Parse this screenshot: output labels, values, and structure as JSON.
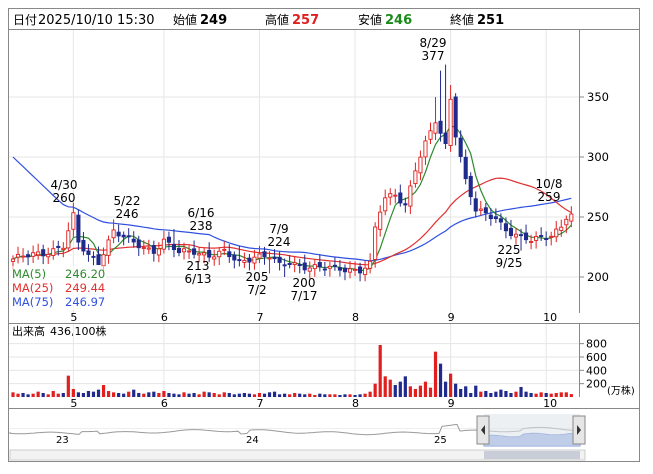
{
  "header": {
    "date_label": "日付",
    "datetime": "2025/10/10 15:30",
    "open_label": "始値",
    "open": "249",
    "high_label": "高値",
    "high": "257",
    "low_label": "安値",
    "low": "246",
    "close_label": "終値",
    "close": "251"
  },
  "legend": {
    "ma5": "MA(5)",
    "ma5_value": "246.20",
    "ma25": "MA(25)",
    "ma25_value": "249.44",
    "ma75": "MA(75)",
    "ma75_value": "246.97"
  },
  "volume_header": {
    "label": "出来高",
    "value": "436,100株"
  },
  "volume_unit": "(万株)",
  "navigator_labels": [
    "23",
    "24",
    "25"
  ],
  "colors": {
    "candle_up": "#e0201f",
    "candle_down": "#1f2a8c",
    "ma5": "#2e8b2e",
    "ma25": "#e03030",
    "ma75": "#3050e0",
    "header_high": "#e0201f",
    "header_low": "#1a8a1a",
    "volume_up": "#e0201f",
    "volume_down": "#1f2a8c",
    "navigator_fill": "#7f9fe0",
    "navigator_thumb": "#c8cdd8"
  },
  "chart_data": [
    {
      "type": "candlestick",
      "title": "",
      "x_ticks": [
        "5",
        "6",
        "7",
        "8",
        "9",
        "10"
      ],
      "y_ticks": [
        200,
        250,
        300,
        350
      ],
      "ylim": [
        170,
        390
      ],
      "grid": true,
      "annotations": [
        {
          "date": "4/30",
          "value": "260"
        },
        {
          "date": "5/22",
          "value": "246"
        },
        {
          "date": "6/16",
          "value": "238"
        },
        {
          "date": "6/13",
          "value": "213"
        },
        {
          "date": "7/9",
          "value": "224"
        },
        {
          "date": "7/2",
          "value": "205"
        },
        {
          "date": "7/17",
          "value": "200"
        },
        {
          "date": "8/29",
          "value": "377"
        },
        {
          "date": "9/25",
          "value": "225"
        },
        {
          "date": "10/8",
          "value": "259"
        }
      ],
      "anchors": [
        {
          "x": 0,
          "v": 215
        },
        {
          "x": 6,
          "v": 220
        },
        {
          "x": 10,
          "v": 226
        },
        {
          "x": 12,
          "v": 250
        },
        {
          "x": 13,
          "v": 228
        },
        {
          "x": 15,
          "v": 218
        },
        {
          "x": 17,
          "v": 213
        },
        {
          "x": 19,
          "v": 230
        },
        {
          "x": 20,
          "v": 238
        },
        {
          "x": 23,
          "v": 230
        },
        {
          "x": 26,
          "v": 225
        },
        {
          "x": 28,
          "v": 222
        },
        {
          "x": 30,
          "v": 230
        },
        {
          "x": 33,
          "v": 220
        },
        {
          "x": 36,
          "v": 222
        },
        {
          "x": 39,
          "v": 218
        },
        {
          "x": 42,
          "v": 220
        },
        {
          "x": 45,
          "v": 212
        },
        {
          "x": 48,
          "v": 218
        },
        {
          "x": 51,
          "v": 217
        },
        {
          "x": 53,
          "v": 209
        },
        {
          "x": 55,
          "v": 212
        },
        {
          "x": 57,
          "v": 210
        },
        {
          "x": 60,
          "v": 208
        },
        {
          "x": 63,
          "v": 207
        },
        {
          "x": 66,
          "v": 207
        },
        {
          "x": 69,
          "v": 206
        },
        {
          "x": 71,
          "v": 210
        },
        {
          "x": 72,
          "v": 240
        },
        {
          "x": 73,
          "v": 255
        },
        {
          "x": 74,
          "v": 265
        },
        {
          "x": 76,
          "v": 270
        },
        {
          "x": 78,
          "v": 260
        },
        {
          "x": 80,
          "v": 290
        },
        {
          "x": 82,
          "v": 310
        },
        {
          "x": 84,
          "v": 330
        },
        {
          "x": 86,
          "v": 310
        },
        {
          "x": 87,
          "v": 350
        },
        {
          "x": 88,
          "v": 320
        },
        {
          "x": 89,
          "v": 300
        },
        {
          "x": 90,
          "v": 280
        },
        {
          "x": 92,
          "v": 255
        },
        {
          "x": 94,
          "v": 252
        },
        {
          "x": 96,
          "v": 250
        },
        {
          "x": 98,
          "v": 240
        },
        {
          "x": 101,
          "v": 232
        },
        {
          "x": 103,
          "v": 230
        },
        {
          "x": 105,
          "v": 233
        },
        {
          "x": 107,
          "v": 236
        },
        {
          "x": 109,
          "v": 242
        },
        {
          "x": 110,
          "v": 250
        },
        {
          "x": 111,
          "v": 251
        }
      ],
      "ma5": {
        "name": "MA(5)"
      },
      "ma25": {
        "name": "MA(25)"
      },
      "ma75": {
        "name": "MA(75)"
      }
    },
    {
      "type": "bar",
      "title": "出来高",
      "y_ticks": [
        200,
        400,
        600,
        800
      ],
      "ylim": [
        0,
        1000
      ],
      "unit": "(万株)",
      "x_ticks": [
        "5",
        "6",
        "7",
        "8",
        "9",
        "10"
      ],
      "values": [
        70,
        50,
        60,
        40,
        50,
        80,
        60,
        40,
        90,
        50,
        60,
        320,
        120,
        70,
        60,
        90,
        80,
        110,
        180,
        90,
        70,
        60,
        50,
        80,
        110,
        60,
        50,
        70,
        80,
        60,
        90,
        60,
        50,
        40,
        70,
        50,
        60,
        40,
        80,
        70,
        60,
        40,
        70,
        60,
        40,
        50,
        60,
        50,
        40,
        60,
        50,
        70,
        80,
        40,
        50,
        40,
        60,
        50,
        40,
        50,
        30,
        50,
        40,
        40,
        40,
        30,
        40,
        40,
        30,
        40,
        50,
        80,
        200,
        780,
        310,
        260,
        180,
        230,
        310,
        160,
        120,
        170,
        230,
        140,
        680,
        500,
        230,
        350,
        200,
        120,
        160,
        60,
        170,
        80,
        90,
        60,
        80,
        110,
        90,
        60,
        80,
        150,
        80,
        60,
        50,
        70,
        60,
        50,
        60,
        70,
        70,
        44
      ]
    }
  ]
}
